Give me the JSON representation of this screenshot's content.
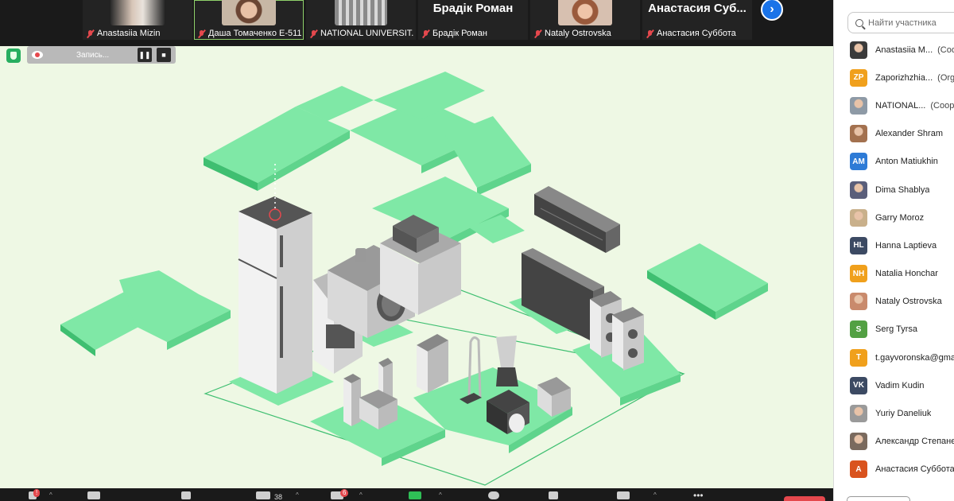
{
  "gallery": {
    "tiles": [
      {
        "name": "Anastasiia Mizin",
        "thumb": "person1"
      },
      {
        "name": "Даша Томаченко Е-511",
        "thumb": "person2"
      },
      {
        "name": "NATIONAL UNIVERSIT...",
        "thumb": "building"
      },
      {
        "name": "Брадік Роман",
        "big": "Брадік Роман"
      },
      {
        "name": "Nataly Ostrovska",
        "thumb": "person3"
      },
      {
        "name": "Анастасия Суббота",
        "big": "Анастасия Суб..."
      }
    ],
    "next_icon": "chevron-right-icon"
  },
  "recording": {
    "label": "Запись...",
    "pause_icon": "pause-icon",
    "stop_icon": "stop-icon"
  },
  "participants": {
    "search_placeholder": "Найти участника",
    "list": [
      {
        "name": "Anastasiia M...",
        "role": "(Coop",
        "initials": "",
        "color": "#3a3a3a",
        "photo": true
      },
      {
        "name": "Zaporizhzhia...",
        "role": "(Orga",
        "initials": "ZP",
        "color": "#f0a01c"
      },
      {
        "name": "NATIONAL...",
        "role": "(Coopr",
        "initials": "",
        "color": "#8e9aa6",
        "photo": true
      },
      {
        "name": "Alexander Shram",
        "role": "",
        "initials": "",
        "color": "#a3714f",
        "photo": true
      },
      {
        "name": "Anton Matiukhin",
        "role": "",
        "initials": "AM",
        "color": "#2e7bd6"
      },
      {
        "name": "Dima Shablya",
        "role": "",
        "initials": "",
        "color": "#5a5e7a",
        "photo": true
      },
      {
        "name": "Garry Moroz",
        "role": "",
        "initials": "",
        "color": "#c9b08b",
        "photo": true
      },
      {
        "name": "Hanna Laptieva",
        "role": "",
        "initials": "HL",
        "color": "#3c4a63"
      },
      {
        "name": "Natalia Honchar",
        "role": "",
        "initials": "NH",
        "color": "#f0a01c"
      },
      {
        "name": "Nataly Ostrovska",
        "role": "",
        "initials": "",
        "color": "#c98a6c",
        "photo": true
      },
      {
        "name": "Serg Tyrsa",
        "role": "",
        "initials": "S",
        "color": "#52a043"
      },
      {
        "name": "t.gayvoronska@gma",
        "role": "",
        "initials": "T",
        "color": "#f0a01c"
      },
      {
        "name": "Vadim Kudin",
        "role": "",
        "initials": "VK",
        "color": "#3c4a63"
      },
      {
        "name": "Yuriy Daneliuk",
        "role": "",
        "initials": "",
        "color": "#9a9a9a",
        "photo": true
      },
      {
        "name": "Александр Степане",
        "role": "",
        "initials": "",
        "color": "#7a6a5e",
        "photo": true
      },
      {
        "name": "Анастасия Суббота",
        "role": "",
        "initials": "A",
        "color": "#d9531e"
      }
    ]
  },
  "toolbar": {
    "participants_count": "38",
    "chat_badge": "6",
    "mic_badge": "!"
  },
  "colors": {
    "accent": "#1a73e8",
    "puzzle": "#7fe8a6",
    "puzzle_dark": "#3fbf71",
    "appliance": "#d9d9d9"
  }
}
